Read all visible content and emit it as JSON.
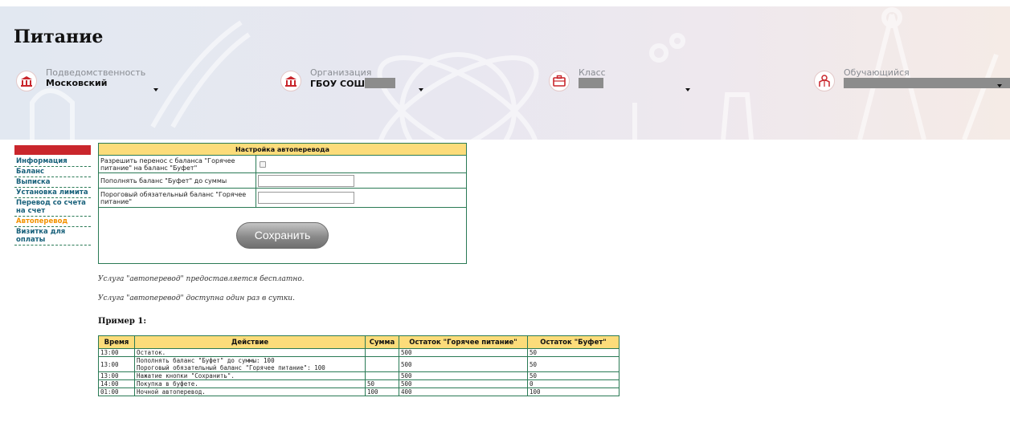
{
  "header": {
    "title": "Питание",
    "filters": [
      {
        "label": "Подведомственность",
        "value": "Московский",
        "icon": "institution-icon"
      },
      {
        "label": "Организация",
        "value": "ГБОУ СОШ",
        "icon": "institution-icon"
      },
      {
        "label": "Класс",
        "value": "",
        "icon": "briefcase-icon"
      },
      {
        "label": "Обучающийся",
        "value": "",
        "icon": "student-icon"
      }
    ]
  },
  "sidebar": {
    "items": [
      {
        "label": "Информация"
      },
      {
        "label": "Баланс"
      },
      {
        "label": "Выписка"
      },
      {
        "label": "Установка лимита"
      },
      {
        "label": "Перевод со счета на счет"
      },
      {
        "label": "Автоперевод",
        "active": true
      },
      {
        "label": "Визитка для оплаты"
      }
    ]
  },
  "settings": {
    "title": "Настройка автоперевода",
    "rows": [
      {
        "label": "Разрешить перенос с баланса \"Горячее питание\" на баланс \"Буфет\"",
        "checked": false
      },
      {
        "label": "Пополнять баланс \"Буфет\" до суммы",
        "value": ""
      },
      {
        "label": "Пороговый обязательный баланс \"Горячее питание\"",
        "value": ""
      }
    ],
    "save_label": "Сохранить"
  },
  "notes": [
    "Услуга \"автоперевод\" предоставляется бесплатно.",
    "Услуга \"автоперевод\" доступна один раз в сутки."
  ],
  "example": {
    "title": "Пример 1:",
    "columns": [
      "Время",
      "Действие",
      "Сумма",
      "Остаток \"Горячее питание\"",
      "Остаток \"Буфет\""
    ],
    "rows": [
      [
        "13:00",
        "Остаток.",
        "",
        "500",
        "50"
      ],
      [
        "13:00",
        "Пополнять баланс \"Буфет\" до суммы: 100\nПороговый обязательный баланс \"Горячее питание\": 100",
        "",
        "500",
        "50"
      ],
      [
        "13:00",
        "Нажатие кнопки \"Сохранить\".",
        "",
        "500",
        "50"
      ],
      [
        "14:00",
        "Покупка в буфете.",
        "50",
        "500",
        "0"
      ],
      [
        "01:00",
        "Ночной автоперевод.",
        "100",
        "400",
        "100"
      ]
    ]
  },
  "colors": {
    "accent_red": "#c9262c",
    "header_yellow": "#fcdc7a",
    "border_green": "#2a7a55",
    "link_teal": "#17607a",
    "active_orange": "#f39200"
  }
}
